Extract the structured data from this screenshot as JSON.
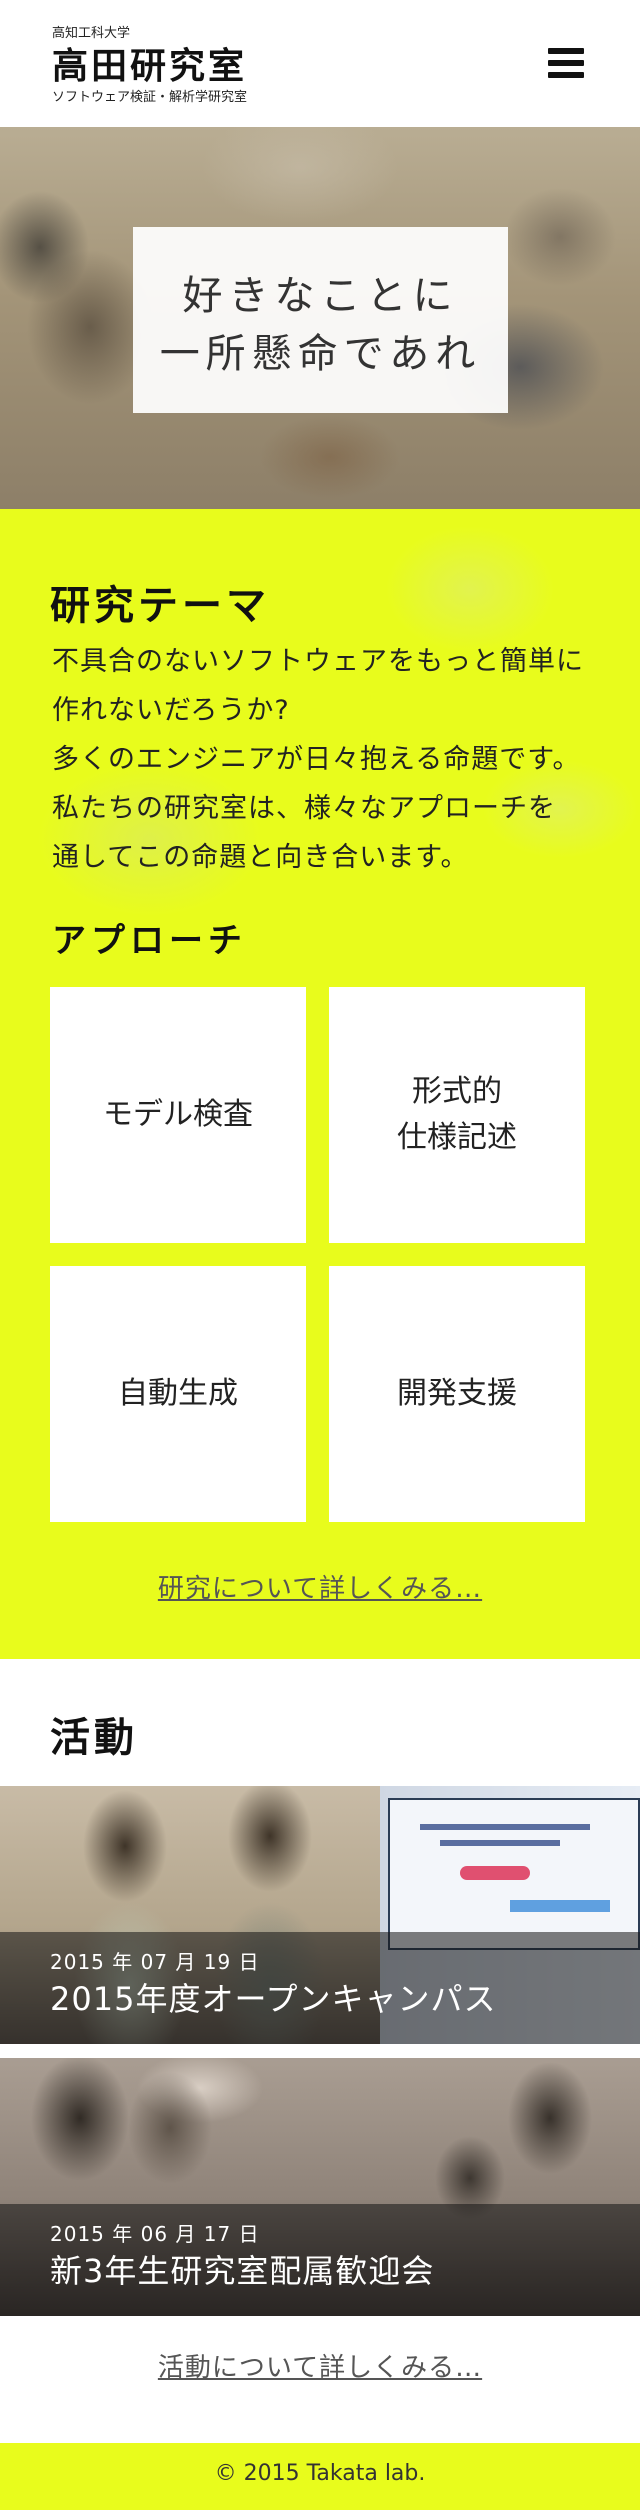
{
  "header": {
    "university": "高知工科大学",
    "lab_name": "高田研究室",
    "subtitle": "ソフトウェア検証・解析学研究室",
    "menu_icon": "hamburger-menu-icon"
  },
  "hero": {
    "line1": "好きなことに",
    "line2": "一所懸命であれ"
  },
  "research": {
    "title": "研究テーマ",
    "description_lines": [
      "不具合のないソフトウェアをもっと簡単に",
      "作れないだろうか?",
      "多くのエンジニアが日々抱える命題です。",
      "私たちの研究室は、様々なアプローチを",
      "通してこの命題と向き合います。"
    ],
    "approach_title": "アプローチ",
    "approaches": [
      {
        "line1": "モデル検査",
        "line2": ""
      },
      {
        "line1": "形式的",
        "line2": "仕様記述"
      },
      {
        "line1": "自動生成",
        "line2": ""
      },
      {
        "line1": "開発支援",
        "line2": ""
      }
    ],
    "more_link": "研究について詳しくみる…",
    "accent_color": "#e8fc1c"
  },
  "activity": {
    "title": "活動",
    "posts": [
      {
        "date": "2015 年 07 月 19 日",
        "title": "2015年度オープンキャンパス"
      },
      {
        "date": "2015 年 06 月 17 日",
        "title": "新3年生研究室配属歓迎会"
      }
    ],
    "more_link": "活動について詳しくみる…"
  },
  "footer": {
    "copyright": "© 2015 Takata lab."
  }
}
